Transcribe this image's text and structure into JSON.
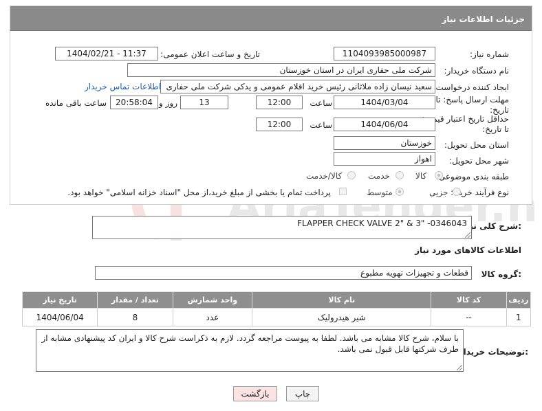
{
  "header": {
    "title": "جزئیات اطلاعات نیاز"
  },
  "form": {
    "need_number_label": "شماره نیاز:",
    "need_number": "1104093985000987",
    "announce_label": "تاریخ و ساعت اعلان عمومی:",
    "announce_value": "1404/02/21 - 11:37",
    "buyer_org_label": "نام دستگاه خریدار:",
    "buyer_org": "شرکت ملی حفاری ایران در استان خوزستان",
    "creator_label": "ایجاد کننده درخواست:",
    "creator": "سعید نیسان زاده ملاثانی رئیس خرید اقلام عمومی و یدکی شرکت ملی حفاری",
    "contact_link": "اطلاعات تماس خریدار",
    "reply_deadline_label": "مهلت ارسال پاسخ: تا تاریخ:",
    "reply_date": "1404/03/04",
    "time_label": "ساعت",
    "reply_time": "12:00",
    "days_value": "13",
    "days_label": "روز و",
    "remaining_time": "20:58:04",
    "remaining_label": "ساعت باقی مانده",
    "price_valid_label": "حداقل تاریخ اعتبار قیمت: تا تاریخ:",
    "price_date": "1404/06/04",
    "price_time": "12:00",
    "province_label": "استان محل تحویل:",
    "province": "خوزستان",
    "city_label": "شهر محل تحویل:",
    "city": "اهواز",
    "category_label": "طبقه بندی موضوعی:",
    "category_options": [
      "کالا",
      "خدمت",
      "کالا/خدمت"
    ],
    "process_label": "نوع فرآیند خرید :",
    "process_options": [
      "جزیی",
      "متوسط"
    ],
    "payment_note": "پرداخت تمام یا بخشی از مبلغ خرید،از محل \"اسناد خزانه اسلامی\" خواهد بود."
  },
  "description": {
    "label": "شرح کلی نیاز:",
    "value": "FLAPPER CHECK VALVE 2\" & 3\" -0346043"
  },
  "goods_section_title": "اطلاعات کالاهای مورد نیاز",
  "goods_group": {
    "label": "گروه کالا:",
    "value": "قطعات و تجهیزات تهویه مطبوع"
  },
  "table": {
    "headers": [
      "ردیف",
      "کد کالا",
      "نام کالا",
      "واحد شمارش",
      "تعداد / مقدار",
      "تاریخ نیاز"
    ],
    "rows": [
      [
        "1",
        "--",
        "شیر هیدرولیک",
        "عدد",
        "8",
        "1404/06/04"
      ]
    ]
  },
  "buyer_notes": {
    "label": "توضیحات خریدار:",
    "value": "با سلام، شرح کالا مشابه می باشد. لطفا به پیوست مراجعه گردد. لازم به ذکراست شرح کالا و ایران کد  پیشنهادی مشابه از طرف شرکتها قابل قبول نمی باشد."
  },
  "buttons": {
    "print": "چاپ",
    "back": "بازگشت"
  },
  "watermark": {
    "text": "AriaTender.net"
  },
  "colors": {
    "header_bg": "#8a8a8a",
    "link": "#1a5fb4",
    "back_button_bg": "#fbe3e3"
  }
}
